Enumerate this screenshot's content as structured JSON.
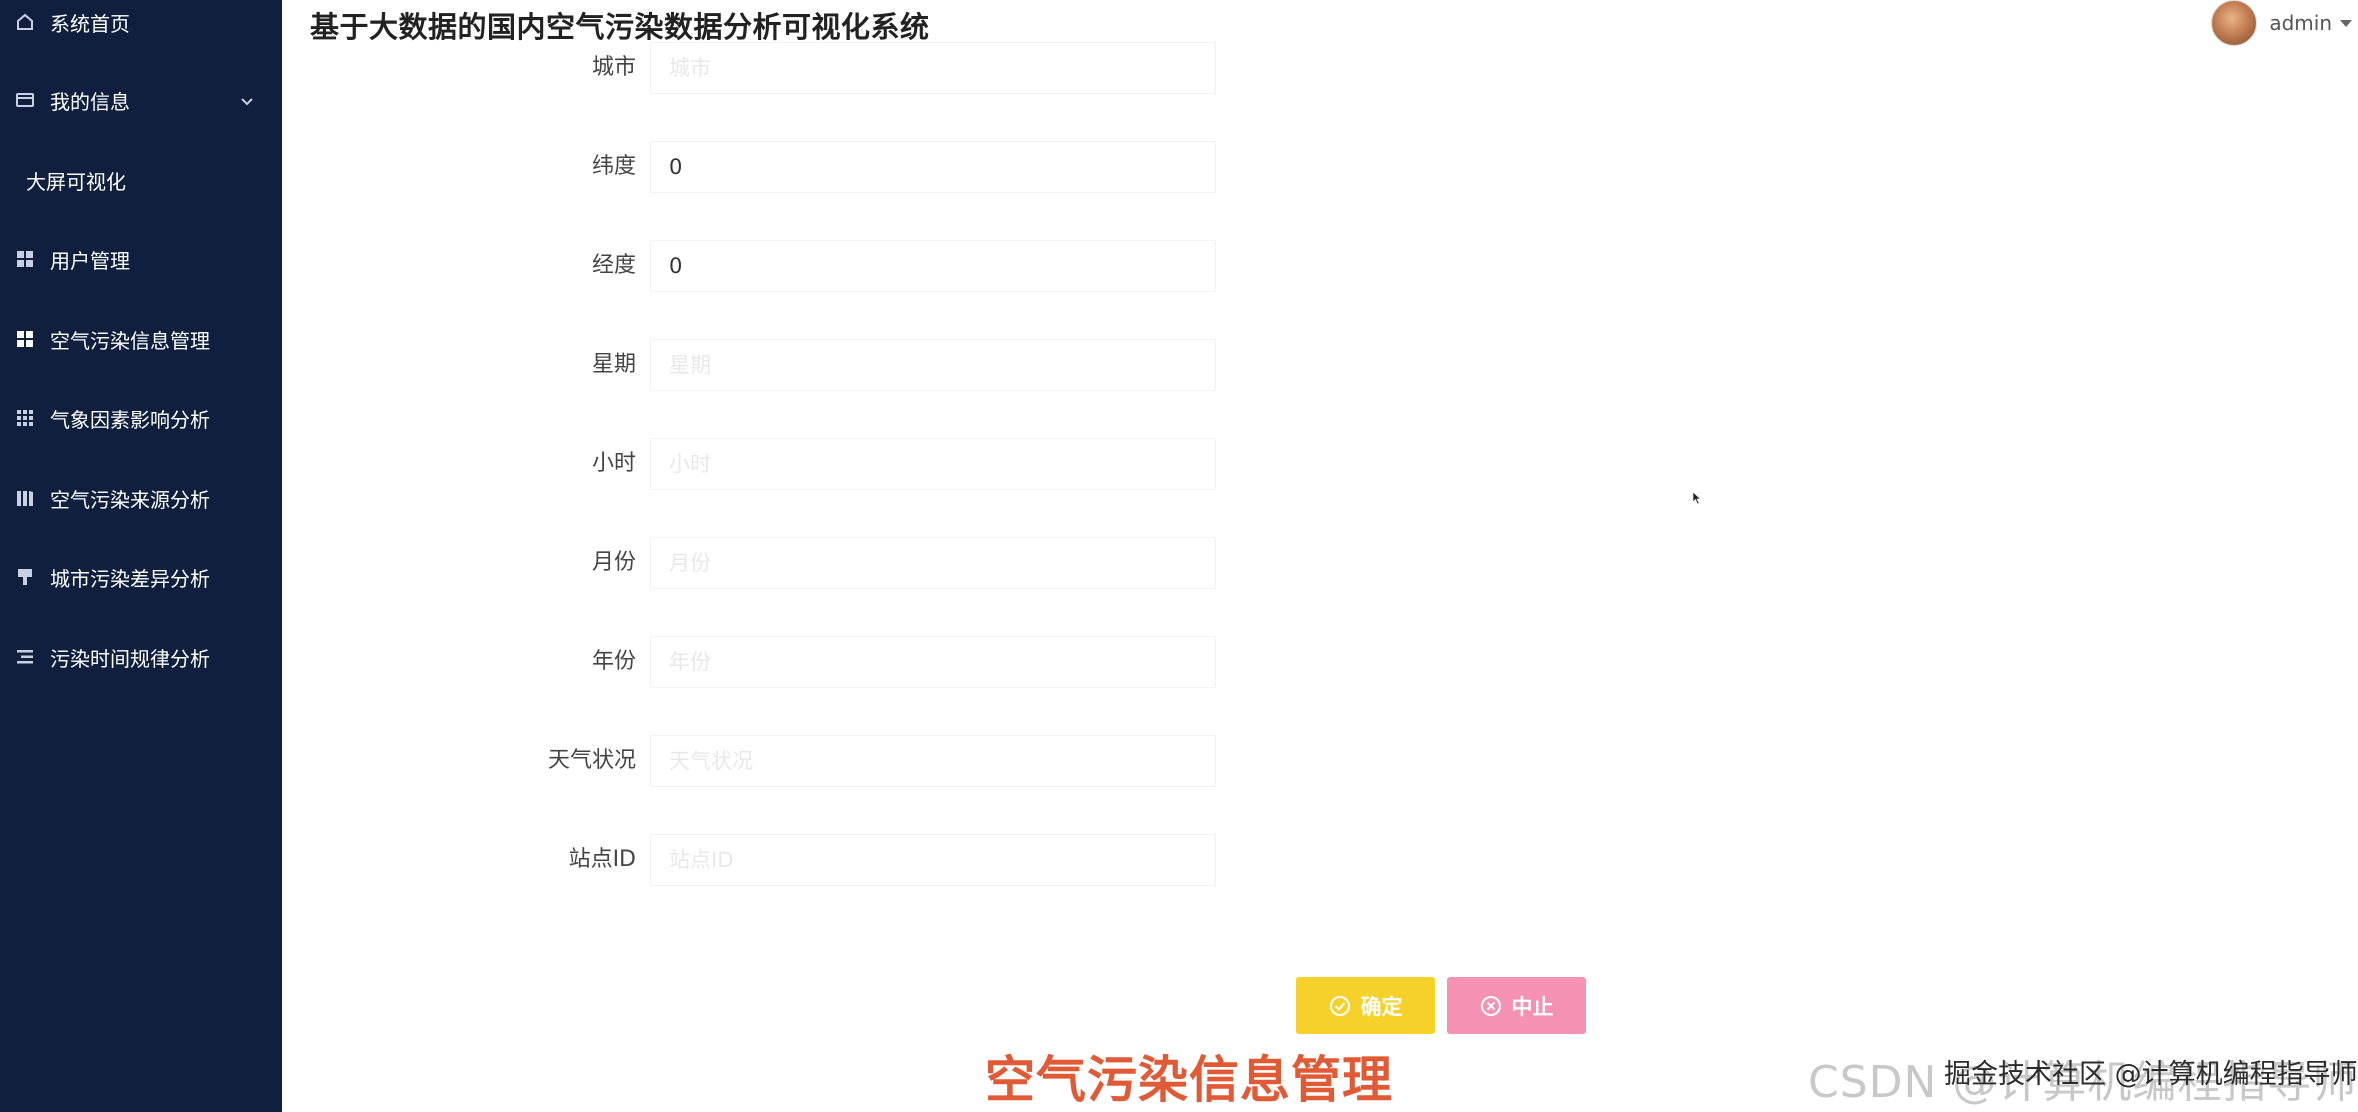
{
  "header": {
    "title": "基于大数据的国内空气污染数据分析可视化系统",
    "username": "admin"
  },
  "sidebar": {
    "items": [
      {
        "label": "系统首页",
        "icon": "home-icon"
      },
      {
        "label": "我的信息",
        "icon": "wallet-icon"
      },
      {
        "label": "大屏可视化",
        "icon": ""
      },
      {
        "label": "用户管理",
        "icon": "grid-icon"
      },
      {
        "label": "空气污染信息管理",
        "icon": "grid-icon"
      },
      {
        "label": "气象因素影响分析",
        "icon": "apps-icon"
      },
      {
        "label": "空气污染来源分析",
        "icon": "book-icon"
      },
      {
        "label": "城市污染差异分析",
        "icon": "brush-icon"
      },
      {
        "label": "污染时间规律分析",
        "icon": "list-icon"
      }
    ]
  },
  "form": {
    "fields": [
      {
        "label": "城市",
        "value": "",
        "placeholder": "城市"
      },
      {
        "label": "纬度",
        "value": "0",
        "placeholder": ""
      },
      {
        "label": "经度",
        "value": "0",
        "placeholder": ""
      },
      {
        "label": "星期",
        "value": "",
        "placeholder": "星期"
      },
      {
        "label": "小时",
        "value": "",
        "placeholder": "小时"
      },
      {
        "label": "月份",
        "value": "",
        "placeholder": "月份"
      },
      {
        "label": "年份",
        "value": "",
        "placeholder": "年份"
      },
      {
        "label": "天气状况",
        "value": "",
        "placeholder": "天气状况"
      },
      {
        "label": "站点ID",
        "value": "",
        "placeholder": "站点ID"
      }
    ],
    "confirm_label": "确定",
    "cancel_label": "中止"
  },
  "caption": "空气污染信息管理",
  "watermark": {
    "csdn": "CSDN @计算机编程指导师",
    "juejin": "掘金技术社区 @计算机编程指导师"
  },
  "colors": {
    "sidebar_bg": "#0f1f3d",
    "confirm": "#f5d12a",
    "cancel": "#f592b4",
    "caption": "#e05a35"
  }
}
